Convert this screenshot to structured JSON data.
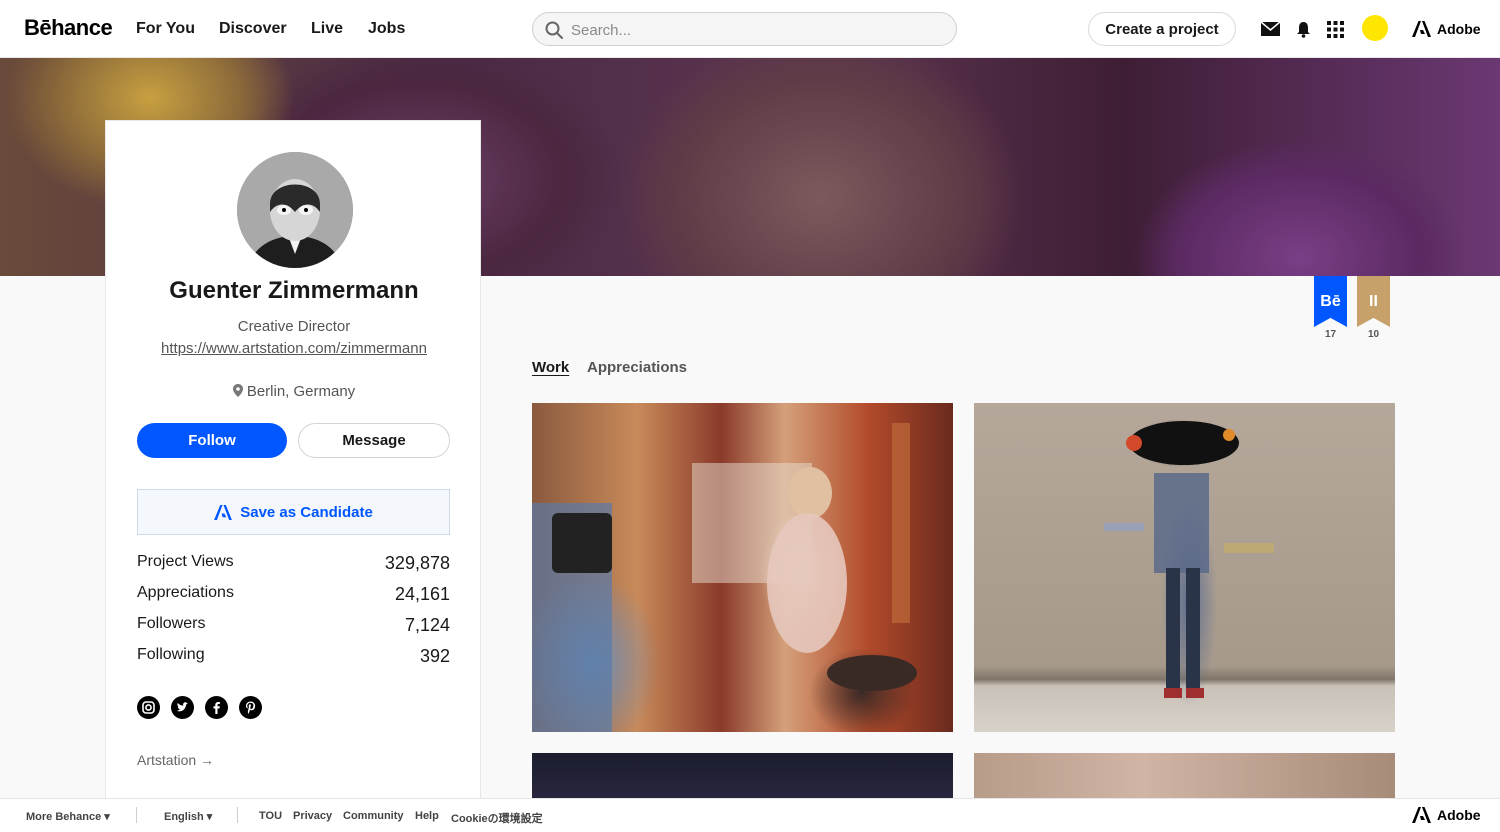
{
  "nav": {
    "logo": "Bēhance",
    "links": [
      "For You",
      "Discover",
      "Live",
      "Jobs"
    ],
    "search_placeholder": "Search...",
    "create_label": "Create a project",
    "adobe_label": "Adobe"
  },
  "profile": {
    "name": "Guenter Zimmermann",
    "occupation": "Creative Director",
    "website": "https://www.artstation.com/zimmermann",
    "location": "Berlin, Germany",
    "follow_label": "Follow",
    "message_label": "Message",
    "candidate_label": "Save as Candidate",
    "stats": [
      {
        "label": "Project Views",
        "value": "329,878"
      },
      {
        "label": "Appreciations",
        "value": "24,161"
      },
      {
        "label": "Followers",
        "value": "7,124"
      },
      {
        "label": "Following",
        "value": "392"
      }
    ],
    "socials": [
      "instagram-icon",
      "twitter-icon",
      "facebook-icon",
      "pinterest-icon"
    ],
    "external_link": "Artstation →"
  },
  "badges": [
    {
      "text": "Bē",
      "count": "17",
      "color": "#0057ff"
    },
    {
      "text": "II",
      "count": "10",
      "color": "#c8a06a"
    }
  ],
  "tabs": [
    "Work",
    "Appreciations"
  ],
  "footer": {
    "more": "More Behance",
    "language": "English",
    "links": [
      "TOU",
      "Privacy",
      "Community",
      "Help",
      "Cookieの環境設定"
    ],
    "adobe_label": "Adobe"
  }
}
